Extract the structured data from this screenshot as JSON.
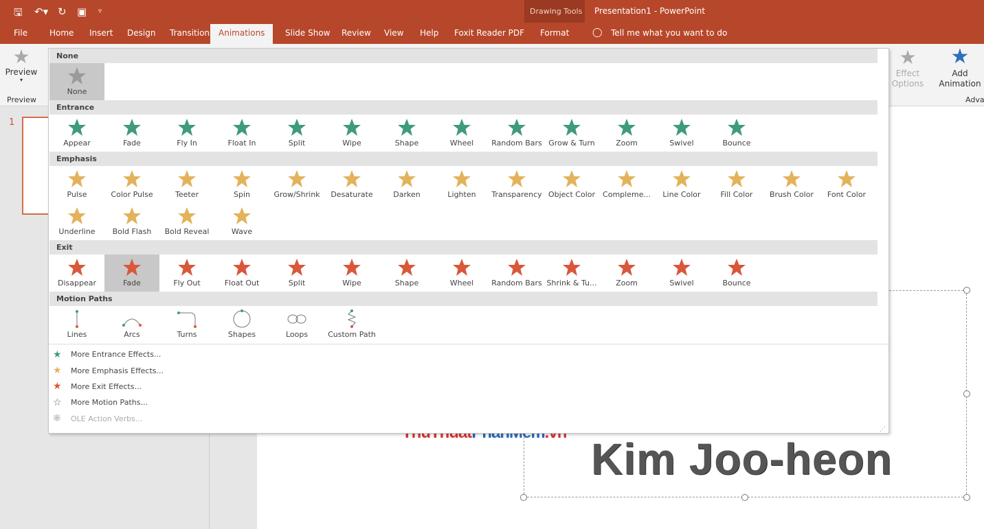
{
  "titlebar": {
    "context": "Drawing Tools",
    "title": "Presentation1  -  PowerPoint",
    "quick_access": [
      "save-icon",
      "undo-icon",
      "redo-icon",
      "present-icon",
      "customize-icon"
    ]
  },
  "tabs": [
    "File",
    "Home",
    "Insert",
    "Design",
    "Transitions",
    "Animations",
    "Slide Show",
    "Review",
    "View",
    "Help",
    "Foxit Reader PDF",
    "Format"
  ],
  "tell_me": "Tell me what you want to do",
  "ribbon": {
    "preview": "Preview",
    "preview_group": "Preview",
    "effect_options": "Effect Options",
    "add_animation": "Add Animation",
    "advanced_group": "Adva"
  },
  "slide_number": "1",
  "slide_text": "Kim Joo-heon",
  "watermark": {
    "a": "ThuThuat",
    "b": "PhanMem",
    "c": ".vn"
  },
  "colors": {
    "accent": "#b7472a",
    "entrance": "#3f9a7e",
    "emphasis": "#e3b25a",
    "exit": "#d9573a",
    "none": "#9a9a9a"
  },
  "gallery": [
    {
      "header": "None",
      "kind": "none",
      "items": [
        "None"
      ],
      "selected": 0
    },
    {
      "header": "Entrance",
      "kind": "entrance",
      "items": [
        "Appear",
        "Fade",
        "Fly In",
        "Float In",
        "Split",
        "Wipe",
        "Shape",
        "Wheel",
        "Random Bars",
        "Grow & Turn",
        "Zoom",
        "Swivel",
        "Bounce"
      ]
    },
    {
      "header": "Emphasis",
      "kind": "emphasis",
      "items": [
        "Pulse",
        "Color Pulse",
        "Teeter",
        "Spin",
        "Grow/Shrink",
        "Desaturate",
        "Darken",
        "Lighten",
        "Transparency",
        "Object Color",
        "Compleme...",
        "Line Color",
        "Fill Color",
        "Brush Color",
        "Font Color",
        "Underline",
        "Bold Flash",
        "Bold Reveal",
        "Wave"
      ]
    },
    {
      "header": "Exit",
      "kind": "exit",
      "items": [
        "Disappear",
        "Fade",
        "Fly Out",
        "Float Out",
        "Split",
        "Wipe",
        "Shape",
        "Wheel",
        "Random Bars",
        "Shrink & Tu...",
        "Zoom",
        "Swivel",
        "Bounce"
      ],
      "selected": 1
    },
    {
      "header": "Motion Paths",
      "kind": "motion",
      "items": [
        "Lines",
        "Arcs",
        "Turns",
        "Shapes",
        "Loops",
        "Custom Path"
      ]
    }
  ],
  "menu": [
    {
      "label": "More Entrance Effects...",
      "icon": "entrance-star-icon",
      "enabled": true
    },
    {
      "label": "More Emphasis Effects...",
      "icon": "emphasis-star-icon",
      "enabled": true
    },
    {
      "label": "More Exit Effects...",
      "icon": "exit-star-icon",
      "enabled": true
    },
    {
      "label": "More Motion Paths...",
      "icon": "motion-star-outline-icon",
      "enabled": true
    },
    {
      "label": "OLE Action Verbs...",
      "icon": "ole-verbs-icon",
      "enabled": false
    }
  ]
}
